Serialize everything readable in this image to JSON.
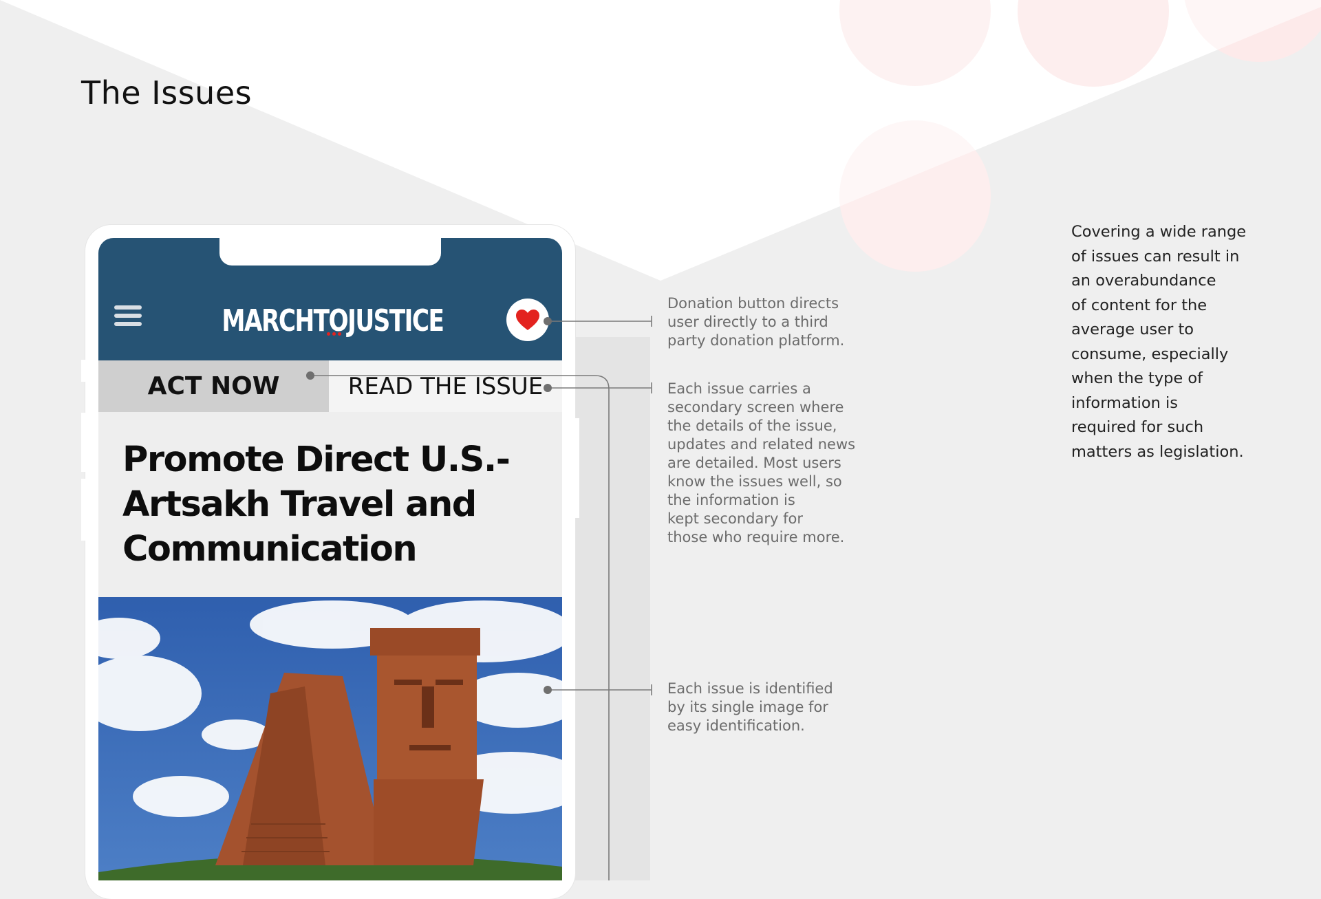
{
  "page": {
    "title": "The Issues",
    "side_note_lines": [
      "Covering a wide range",
      "of issues can result in",
      "an overabundance",
      "of content for the",
      "average user to",
      "consume, especially",
      "when the type of",
      "information is",
      "required for such",
      "matters as legislation."
    ]
  },
  "app": {
    "brand_name": "MARCHTOJUSTICE",
    "tabs": {
      "act_now": "ACT NOW",
      "read_issue": "READ THE ISSUE"
    },
    "issue_title_lines": [
      "Promote Direct U.S.-",
      "Artsakh Travel and",
      "Communication"
    ],
    "icons": {
      "menu": "hamburger-menu-icon",
      "donate": "heart-icon"
    },
    "colors": {
      "header": "#265374",
      "heart": "#e3231f",
      "active_tab": "#cfcfcf"
    }
  },
  "annotations": {
    "donation": [
      "Donation button directs",
      "user directly to a third",
      "party donation platform."
    ],
    "secondary_screen": [
      "Each issue carries a",
      "secondary screen where",
      "the details of the issue,",
      "updates and related news",
      "are detailed. Most users",
      "know the issues well, so",
      "the information is",
      "kept secondary for",
      "those who require more."
    ],
    "image": [
      "Each issue is identified",
      "by its single image for",
      "easy identification."
    ]
  }
}
